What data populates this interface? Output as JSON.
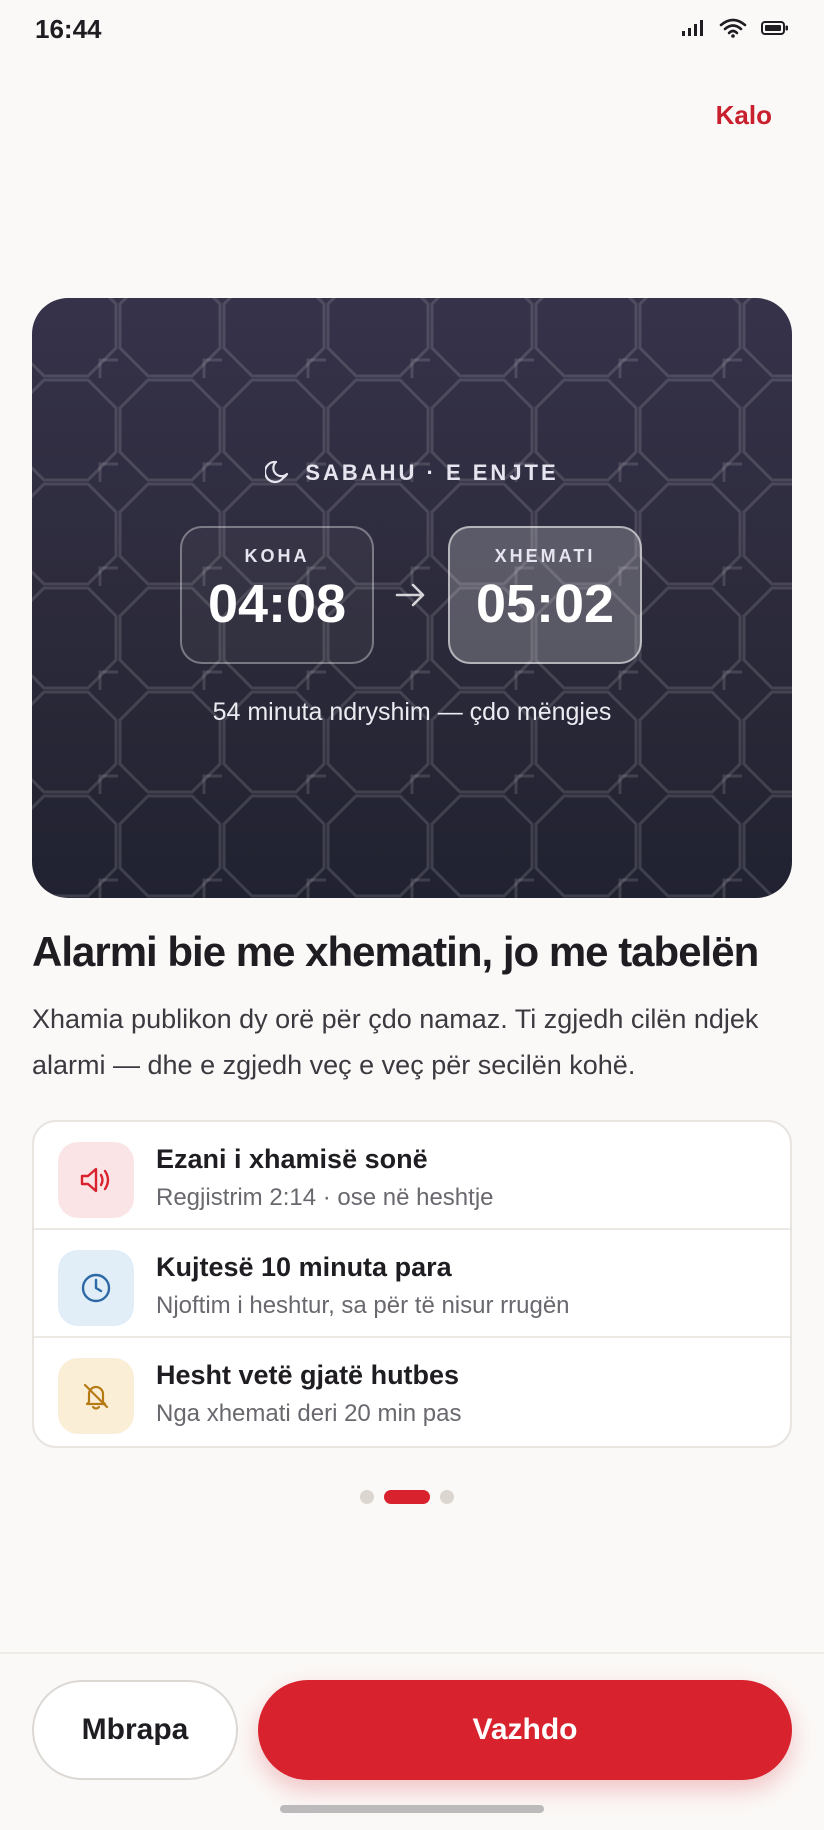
{
  "status_bar": {
    "time": "16:44",
    "icons": [
      "signal-icon",
      "wifi-icon",
      "battery-icon"
    ]
  },
  "header": {
    "skip_label": "Kalo"
  },
  "hero": {
    "label": "SABAHU · E ENJTE",
    "moon_icon": "moon-icon",
    "start": {
      "label": "KOHA",
      "time": "04:08"
    },
    "congregation": {
      "label": "XHEMATI",
      "time": "05:02"
    },
    "difference": "54 minuta ndryshim — çdo mëngjes"
  },
  "title": "Alarmi bie me xhematin, jo me tabelën",
  "description": "Xhamia publikon dy orë për çdo namaz. Ti zgjedh cilën ndjek alarmi — dhe e zgjedh veç e veç për secilën kohë.",
  "features": [
    {
      "icon": "speaker-icon",
      "title": "Ezani i xhamisë sonë",
      "subtitle": "Regjistrim 2:14 · ose në heshtje"
    },
    {
      "icon": "clock-icon",
      "title": "Kujtesë 10 minuta para",
      "subtitle": "Njoftim i heshtur, sa për të nisur rrugën"
    },
    {
      "icon": "bell-off-icon",
      "title": "Hesht vetë gjatë hutbes",
      "subtitle": "Nga xhemati deri 20 min pas"
    }
  ],
  "pagination": {
    "total": 3,
    "current": 2
  },
  "footer": {
    "back_label": "Mbrapa",
    "next_label": "Vazhdo"
  },
  "colors": {
    "accent": "#d8232f",
    "hero_top": "#36324a",
    "hero_bottom": "#212231",
    "background": "#fbf9f7"
  }
}
